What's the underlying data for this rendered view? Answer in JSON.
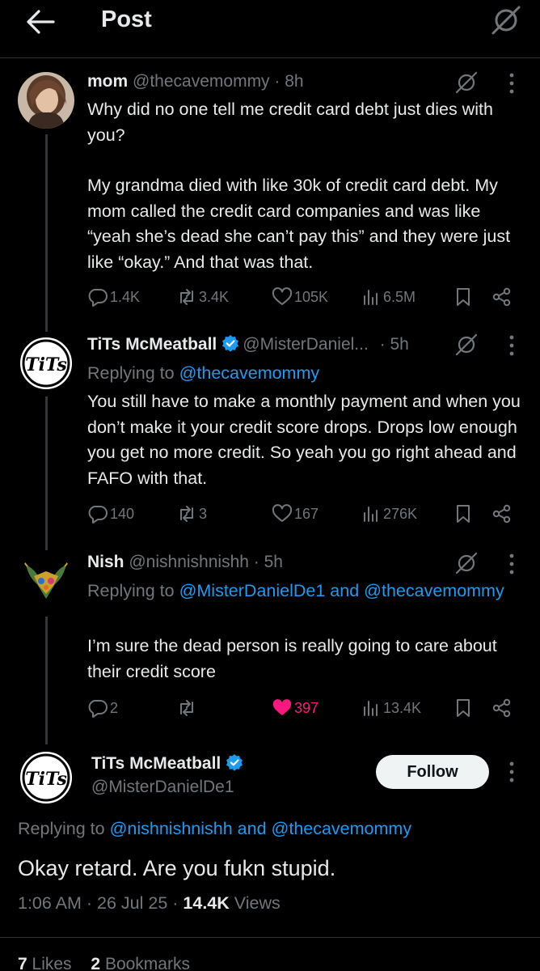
{
  "header": {
    "title": "Post"
  },
  "tweets": [
    {
      "name": "mom",
      "handle": "@thecavemommy",
      "time": "· 8h",
      "paragraphs": [
        "Why did no one tell me credit card debt just dies with you?",
        "My grandma died with like 30k of credit card debt. My mom called the credit card companies and was like “yeah she’s dead she can’t pay this” and they were just like “okay.” And that was that."
      ],
      "replies": "1.4K",
      "reposts": "3.4K",
      "likes": "105K",
      "views": "6.5M"
    },
    {
      "name": "TiTs McMeatball",
      "handle": "@MisterDaniel...",
      "time": "· 5h",
      "replying_label": "Replying to",
      "replying_to": "@thecavemommy",
      "text": "You still have to make a monthly payment and when you don’t make it your credit score drops. Drops low enough you get no more credit. So yeah you go right ahead and FAFO with that.",
      "replies": "140",
      "reposts": "3",
      "likes": "167",
      "views": "276K"
    },
    {
      "name": "Nish",
      "handle": "@nishnishnishh",
      "time": "· 5h",
      "replying_label": "Replying to",
      "replying_to_1": "@MisterDanielDe1",
      "replying_and": "and",
      "replying_to_2": "@thecavemommy",
      "text": "I’m sure the dead person is really going to care about their credit score",
      "replies": "2",
      "likes": "397"
    }
  ],
  "main_post": {
    "name": "TiTs McMeatball",
    "handle": "@MisterDanielDe1",
    "follow_label": "Follow",
    "replying_label": "Replying to",
    "replying_to_1": "@nishnishnishh",
    "replying_and": "and",
    "replying_to_2": "@thecavemommy",
    "text": "Okay retard. Are you fukn stupid.",
    "time": "1:06 AM",
    "date": "26 Jul 25",
    "views_count": "14.4K",
    "views_label": "Views",
    "likes_count": "7",
    "likes_label": "Likes",
    "bookmarks_count": "2",
    "bookmarks_label": "Bookmarks"
  },
  "logo_text": "TiTs",
  "icons": [
    "back-arrow-icon",
    "grok-icon",
    "more-icon",
    "reply-icon",
    "repost-icon",
    "like-icon",
    "views-icon",
    "bookmark-icon",
    "share-icon",
    "verified-icon"
  ],
  "colors": {
    "background": "#000000",
    "text": "#e7e9ea",
    "secondary": "#71767b",
    "link": "#1d9bf0",
    "like": "#f91880",
    "verified": "#1d9bf0"
  }
}
